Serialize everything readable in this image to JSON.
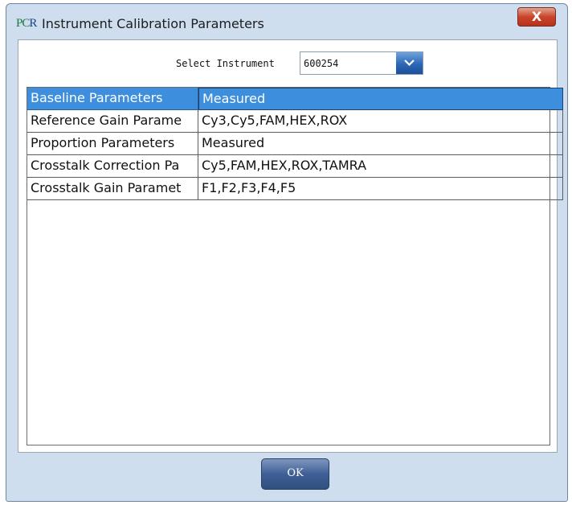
{
  "window": {
    "logo": {
      "p": "P",
      "c": "C",
      "r": "R"
    },
    "title": "Instrument Calibration Parameters",
    "close_label": "X"
  },
  "selector": {
    "label": "Select Instrument",
    "value": "600254"
  },
  "table": {
    "header": [
      "Baseline Parameters",
      "Measured"
    ],
    "rows": [
      [
        "Reference Gain Parame",
        "Cy3,Cy5,FAM,HEX,ROX"
      ],
      [
        "Proportion Parameters",
        "Measured"
      ],
      [
        "Crosstalk Correction Pa",
        "Cy5,FAM,HEX,ROX,TAMRA"
      ],
      [
        "Crosstalk Gain Paramet",
        "F1,F2,F3,F4,F5"
      ]
    ]
  },
  "footer": {
    "ok_label": "OK"
  },
  "colors": {
    "header_bg": "#3d8fde",
    "window_frame": "#cfdeef",
    "close_red": "#c9452a",
    "ok_button": "#3f5f96"
  },
  "icons": {
    "dropdown": "chevron-down-icon",
    "close": "close-icon"
  }
}
